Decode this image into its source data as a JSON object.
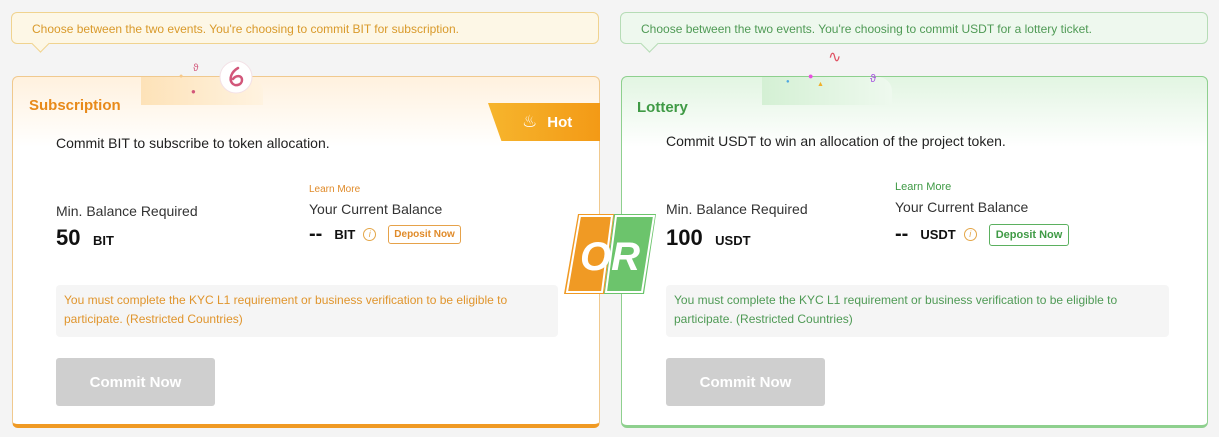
{
  "subscription": {
    "tip": "Choose between the two events. You're choosing to commit BIT for subscription.",
    "title": "Subscription",
    "hot_label": "Hot",
    "description": "Commit BIT to subscribe to token allocation.",
    "min_balance_label": "Min. Balance Required",
    "min_balance_value": "50",
    "min_balance_unit": "BIT",
    "learn_more": "Learn More",
    "current_balance_label": "Your Current Balance",
    "current_balance_value": "--",
    "current_balance_unit": "BIT",
    "deposit_label": "Deposit Now",
    "notice_text": "You must complete the KYC L1 requirement or business verification to be eligible to participate. (",
    "notice_link": "Restricted Countries",
    "notice_close": ")",
    "commit_label": "Commit Now",
    "accent_color": "#f09a24"
  },
  "lottery": {
    "tip": "Choose between the two events. You're choosing to commit USDT for a lottery ticket.",
    "title": "Lottery",
    "description": "Commit USDT to win an allocation of the project token.",
    "min_balance_label": "Min. Balance Required",
    "min_balance_value": "100",
    "min_balance_unit": "USDT",
    "learn_more": "Learn More",
    "current_balance_label": "Your Current Balance",
    "current_balance_value": "--",
    "current_balance_unit": "USDT",
    "deposit_label": "Deposit Now",
    "notice_text": "You must complete the KYC L1 requirement or business verification to be eligible to participate. (",
    "notice_link": "Restricted Countries",
    "notice_close": ")",
    "commit_label": "Commit Now",
    "accent_color": "#5bb05f"
  },
  "divider": {
    "text": "OR",
    "left_color": "#f09a24",
    "right_color": "#6cc46c"
  },
  "icons": {
    "hot": "flame-icon",
    "info": "info-icon",
    "logo": "bit-logo-icon"
  }
}
